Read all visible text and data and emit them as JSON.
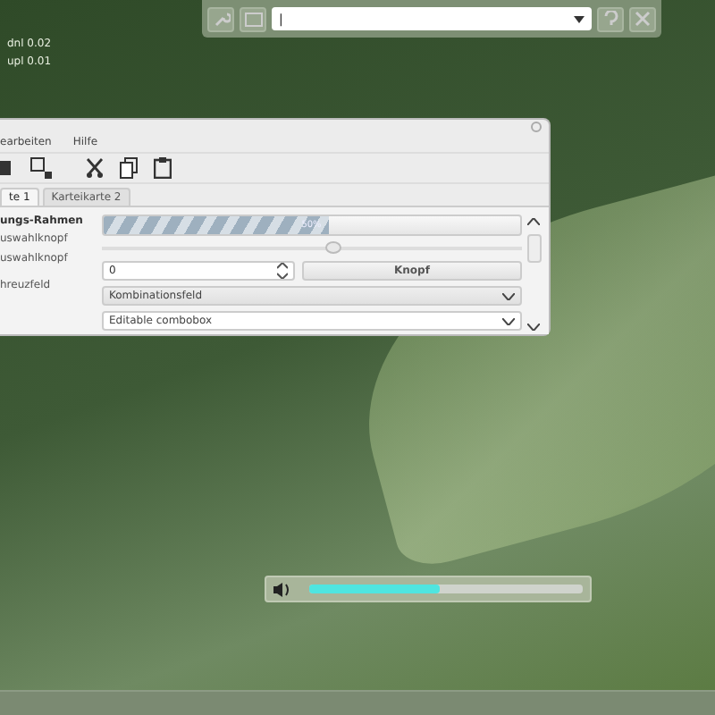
{
  "top_panel": {
    "command_field": {
      "value": "|"
    }
  },
  "net_stats": [
    "dnl 0.02",
    "upl 0.01"
  ],
  "window": {
    "menu": [
      "earbeiten",
      "Hilfe"
    ],
    "tabs": [
      {
        "label": "te 1",
        "selected": true
      },
      {
        "label": "Karteikarte 2",
        "selected": false
      }
    ],
    "labels": [
      {
        "text": "ungs-Rahmen",
        "bold": true
      },
      {
        "text": "uswahlknopf",
        "bold": false
      },
      {
        "text": "uswahlknopf",
        "bold": false
      },
      {
        "text": "hreuzfeld",
        "bold": false
      }
    ],
    "progress": {
      "level": 0.54,
      "reading": "50%"
    },
    "slider": {
      "level": 0.55
    },
    "spin": {
      "value": "0"
    },
    "button": "Knopf",
    "combobox": {
      "value": "Kombinationsfeld"
    },
    "editable_combobox": {
      "value": "Editable combobox"
    }
  },
  "volume": {
    "level": 0.48
  }
}
